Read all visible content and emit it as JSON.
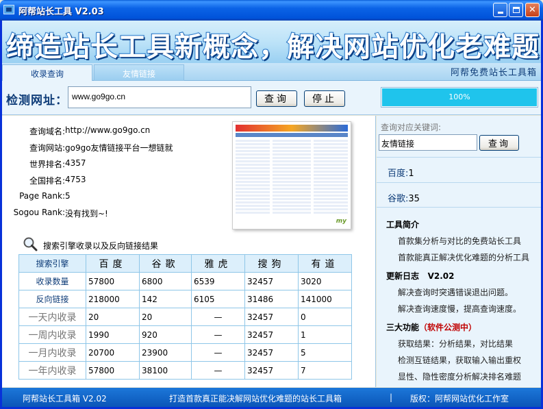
{
  "window": {
    "title": "阿帮站长工具 V2.03",
    "minimize_icon": "minimize-icon",
    "maximize_icon": "maximize-icon",
    "close_icon": "close-icon",
    "close_glyph": "✕"
  },
  "banner": {
    "slogan": "缔造站长工具新概念，解决网站优化老难题！"
  },
  "tabs": [
    {
      "label": "收录查询",
      "active": true
    },
    {
      "label": "友情链接",
      "active": false
    }
  ],
  "toolbox_label": "阿帮免费站长工具箱",
  "url_bar": {
    "label": "检测网址：",
    "value": "www.go9go.cn",
    "query_button": "查询",
    "stop_button": "停止",
    "progress_text": "100%",
    "progress_fraction": 1.0
  },
  "site_info": [
    {
      "key": "查询域名:",
      "value": "http://www.go9go.cn"
    },
    {
      "key": "查询网站:",
      "value": "go9go友情链接平台一想链就"
    },
    {
      "key": "世界排名:",
      "value": "4357"
    },
    {
      "key": "全国排名:",
      "value": "4753"
    },
    {
      "key": "Page Rank:",
      "value": "5"
    },
    {
      "key": "Sogou Rank:",
      "value": "没有找到~!"
    }
  ],
  "thumbnail": {
    "logo_text": "my"
  },
  "results": {
    "title": "搜索引擎收录以及反向链接结果",
    "headers": [
      "搜索引擎",
      "百度",
      "谷歌",
      "雅虎",
      "搜狗",
      "有道"
    ],
    "rows": [
      {
        "label": "收录数量",
        "style": "strong",
        "values": [
          "57800",
          "6800",
          "6539",
          "32457",
          "3020"
        ]
      },
      {
        "label": "反向链接",
        "style": "strong",
        "values": [
          "218000",
          "142",
          "6105",
          "31486",
          "141000"
        ]
      },
      {
        "label": "一天内收录",
        "style": "muted",
        "values": [
          "20",
          "20",
          "—",
          "32457",
          "0"
        ]
      },
      {
        "label": "一周内收录",
        "style": "muted",
        "values": [
          "1990",
          "920",
          "—",
          "32457",
          "1"
        ]
      },
      {
        "label": "一月内收录",
        "style": "muted",
        "values": [
          "20700",
          "23900",
          "—",
          "32457",
          "5"
        ]
      },
      {
        "label": "一年内收录",
        "style": "muted",
        "values": [
          "57800",
          "38100",
          "—",
          "32457",
          "7"
        ]
      }
    ]
  },
  "side": {
    "kw_label": "查询对应关键词:",
    "kw_value": "友情链接",
    "kw_button": "查询",
    "baidu": "百度:",
    "baidu_val": "1",
    "google": "谷歌:",
    "google_val": "35",
    "intro_title": "工具简介",
    "intro_items": [
      "首款集分析与对比的免费站长工具",
      "首款能真正解决优化难题的分析工具"
    ],
    "log_title": "更新日志",
    "log_version": "V2.02",
    "log_items": [
      "解决查询时突遇错误退出问题。",
      "解决查询速度慢，提高查询速度。"
    ],
    "features_title": "三大功能",
    "features_note": "（软件公测中）",
    "features_items": [
      "获取结果：分析结果，对比结果",
      "检测互链结果，获取输入输出重权",
      "显性、隐性密度分析解决排名难题"
    ]
  },
  "status": {
    "left": "阿帮站长工具箱 V2.02",
    "mid": "打造首款真正能决解网站优化难题的站长工具箱",
    "sep": "|",
    "right": "版权：阿帮网站优化工作室"
  }
}
